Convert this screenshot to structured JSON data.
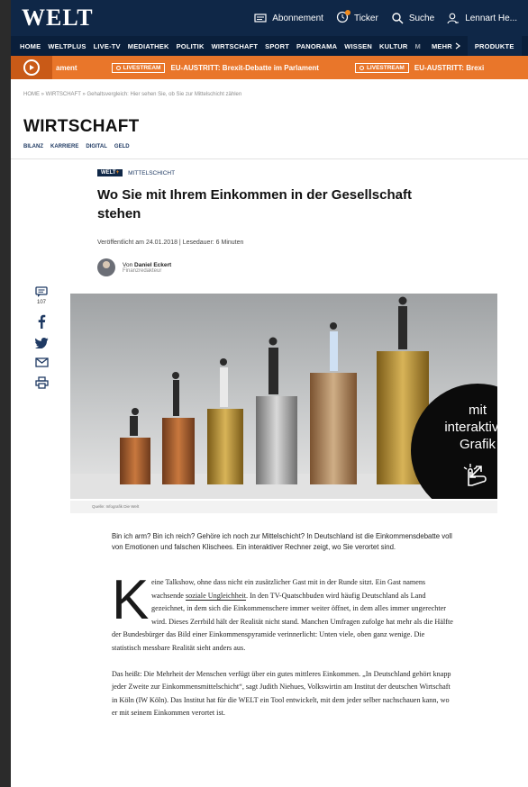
{
  "header": {
    "logo": "WELT",
    "actions": {
      "abonnement": "Abonnement",
      "ticker": "Ticker",
      "suche": "Suche",
      "user": "Lennart He..."
    }
  },
  "nav": {
    "items": [
      "HOME",
      "WELTPLUS",
      "LIVE-TV",
      "MEDIATHEK",
      "POLITIK",
      "WIRTSCHAFT",
      "SPORT",
      "PANORAMA",
      "WISSEN",
      "KULTUR"
    ],
    "faded": "M",
    "more": "MEHR",
    "produkte": "PRODUKTE"
  },
  "ticker": {
    "left_label": "ament",
    "live_label": "LIVESTREAM",
    "headline": "EU-AUSTRITT: Brexit-Debatte im Parlament",
    "repeat_headline": "EU-AUSTRITT: Brexi"
  },
  "breadcrumb": "HOME » WIRTSCHAFT » Gehaltsvergleich: Hier sehen Sie, ob Sie zur Mittelschicht zählen",
  "section": {
    "title": "WIRTSCHAFT",
    "subnav": [
      "BILANZ",
      "KARRIERE",
      "DIGITAL",
      "GELD"
    ]
  },
  "article": {
    "badge": "WELT",
    "badge_plus": "+",
    "kicker": "MITTELSCHICHT",
    "headline": "Wo Sie mit Ihrem Einkommen in der Gesellschaft stehen",
    "meta": "Veröffentlicht am 24.01.2018 | Lesedauer: 6 Minuten",
    "author_prefix": "Von",
    "author": "Daniel Eckert",
    "author_role": "Finanzredakteur"
  },
  "social": {
    "comments_count": "107"
  },
  "hero": {
    "cta_line1": "mit",
    "cta_line2": "interaktiver",
    "cta_line3": "Grafik",
    "caption": "Quelle: Infografik Die Welt"
  },
  "lead": "Bin ich arm? Bin ich reich? Gehöre ich noch zur Mittelschicht? In Deutschland ist die Einkommensdebatte voll von Emotionen und falschen Klischees. Ein interaktiver Rechner zeigt, wo Sie verortet sind.",
  "body": {
    "dropcap": "K",
    "p1_before_link": "eine Talkshow, ohne dass nicht ein zusätzlicher Gast mit in der Runde sitzt. Ein Gast namens wachsende ",
    "p1_link": "soziale Ungleichheit",
    "p1_after_link": ". In den TV-Quatschbuden wird häufig Deutschland als Land gezeichnet, in dem sich die Einkommenschere immer weiter öffnet, in dem alles immer ungerechter wird. Dieses Zerrbild hält der Realität nicht stand. Manchen Umfragen zufolge hat mehr als die Hälfte der Bundesbürger das Bild einer Einkommenspyramide verinnerlicht: Unten viele, oben ganz wenige. Die statistisch messbare Realität sieht anders aus.",
    "p2": "Das heißt: Die Mehrheit der Menschen verfügt über ein gutes mittleres Einkommen. „In Deutschland gehört knapp jeder Zweite zur Einkommensmittelschicht“, sagt Judith Niehues, Volkswirtin am Institut der deutschen Wirtschaft in Köln (IW Köln). Das Institut hat für die WELT ein Tool entwickelt, mit dem jeder selber nachschauen kann, wo er mit seinem Einkommen verortet ist."
  },
  "colors": {
    "navy": "#0f2747",
    "orange": "#e9762a",
    "accent_orange": "#f18a1c"
  }
}
